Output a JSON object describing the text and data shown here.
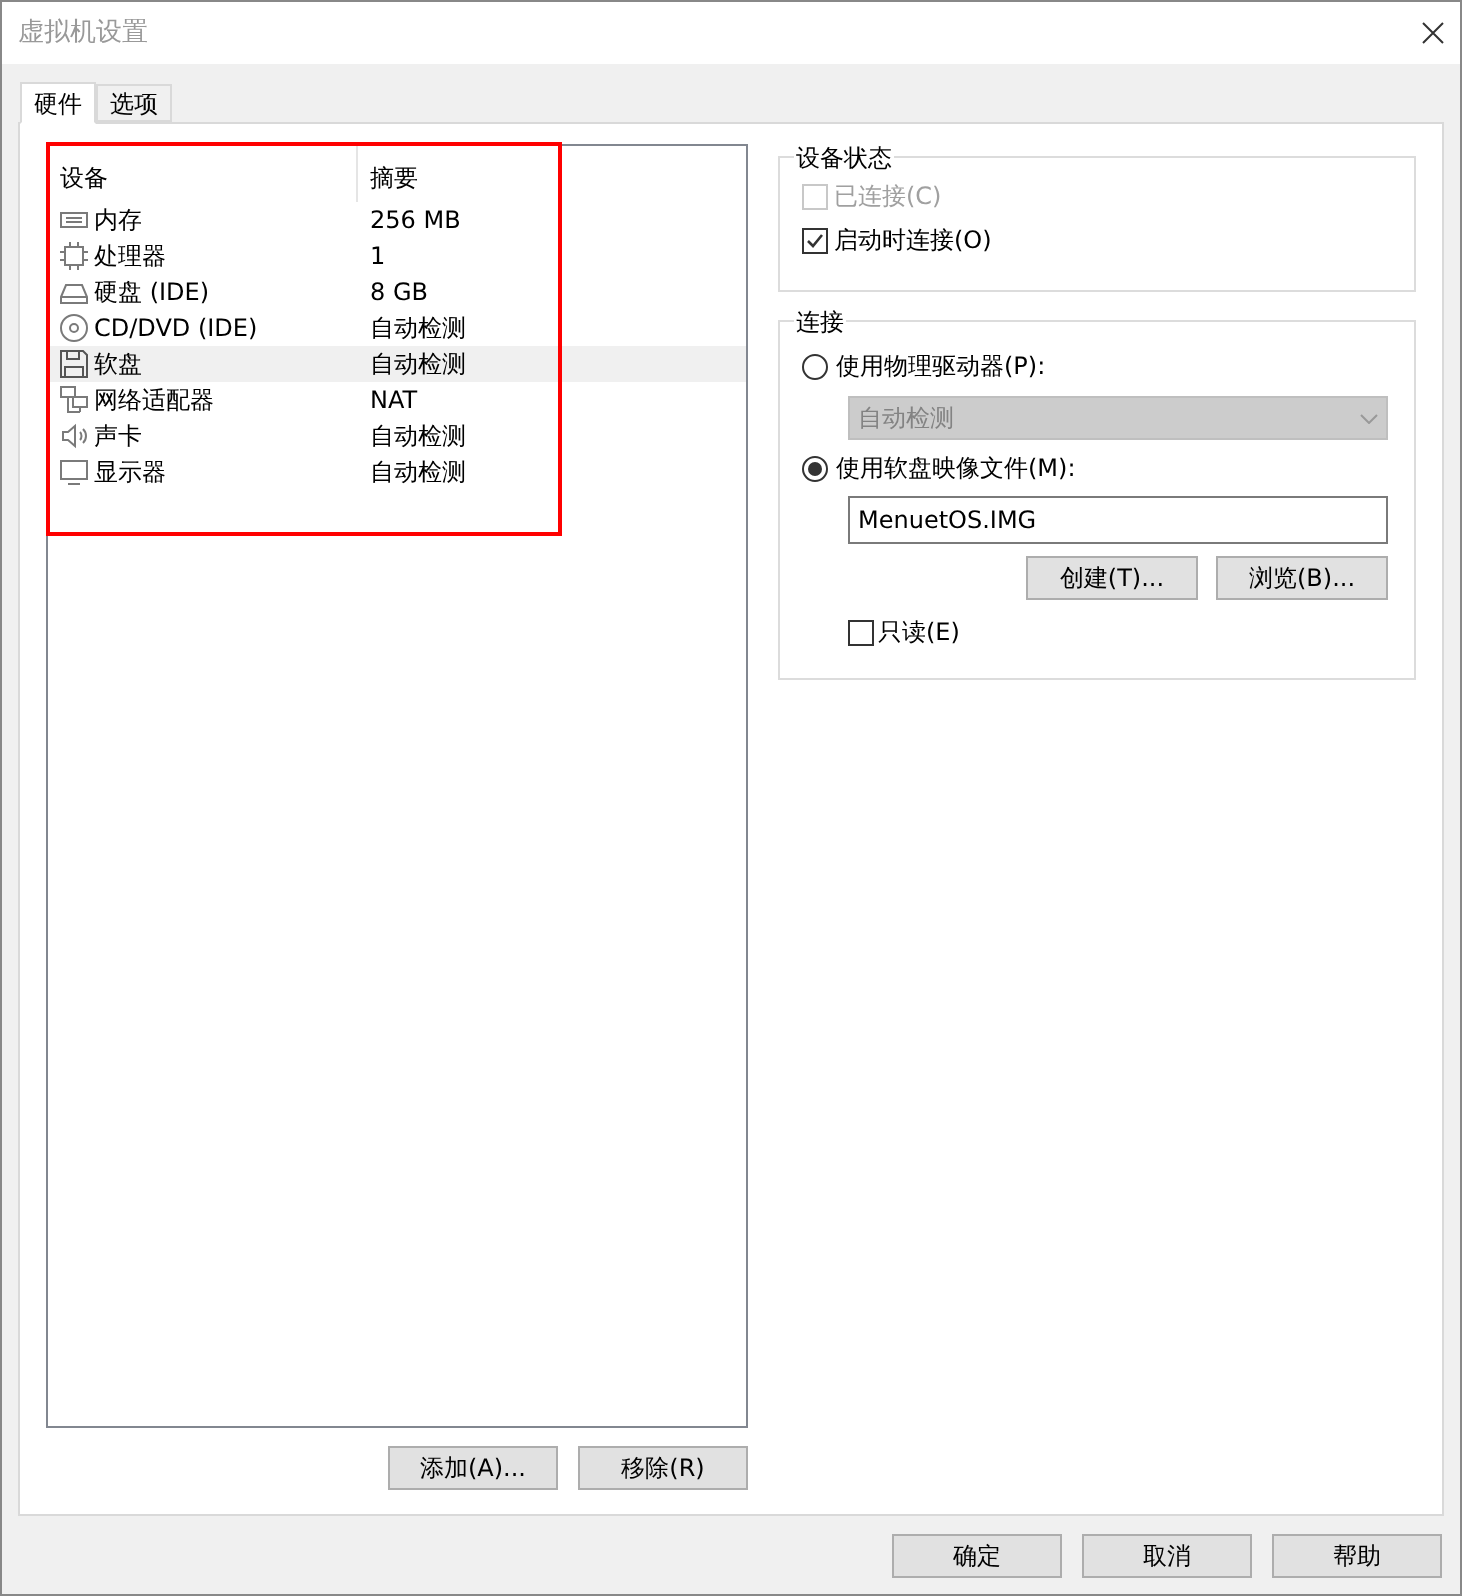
{
  "window": {
    "title": "虚拟机设置"
  },
  "tabs": [
    {
      "label": "硬件",
      "selected": true
    },
    {
      "label": "选项",
      "selected": false
    }
  ],
  "device_table": {
    "columns": [
      "设备",
      "摘要"
    ],
    "rows": [
      {
        "kind": "memory",
        "device": "内存",
        "summary": "256 MB",
        "selected": false
      },
      {
        "kind": "cpu",
        "device": "处理器",
        "summary": "1",
        "selected": false
      },
      {
        "kind": "disk",
        "device": "硬盘 (IDE)",
        "summary": "8 GB",
        "selected": false
      },
      {
        "kind": "cdrom",
        "device": "CD/DVD (IDE)",
        "summary": "自动检测",
        "selected": false
      },
      {
        "kind": "floppy",
        "device": "软盘",
        "summary": "自动检测",
        "selected": true
      },
      {
        "kind": "network",
        "device": "网络适配器",
        "summary": "NAT",
        "selected": false
      },
      {
        "kind": "sound",
        "device": "声卡",
        "summary": "自动检测",
        "selected": false
      },
      {
        "kind": "display",
        "device": "显示器",
        "summary": "自动检测",
        "selected": false
      }
    ]
  },
  "list_buttons": [
    "添加(A)...",
    "移除(R)"
  ],
  "device_status": {
    "title": "设备状态",
    "options": [
      {
        "label": "已连接(C)",
        "checked": false,
        "disabled": true
      },
      {
        "label": "启动时连接(O)",
        "checked": true,
        "disabled": false
      }
    ]
  },
  "connection": {
    "title": "连接",
    "physical": {
      "label": "使用物理驱动器(P):",
      "selected": false,
      "dropdown": {
        "value": "自动检测",
        "disabled": true
      }
    },
    "image": {
      "label": "使用软盘映像文件(M):",
      "selected": true,
      "value": "MenuetOS.IMG"
    },
    "buttons": [
      "创建(T)...",
      "浏览(B)..."
    ],
    "readonly": {
      "label": "只读(E)",
      "checked": false
    }
  },
  "footer_buttons": [
    "确定",
    "取消",
    "帮助"
  ]
}
